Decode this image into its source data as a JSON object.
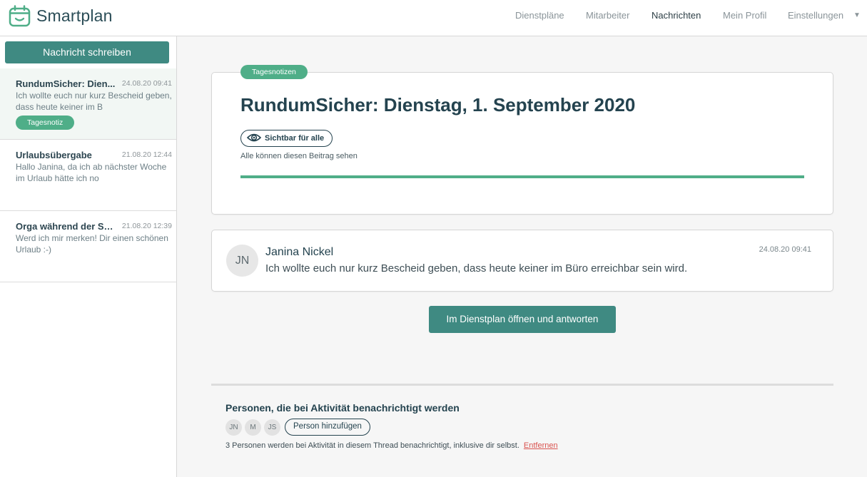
{
  "app": {
    "name": "Smartplan",
    "icon": "calendar-smile-icon",
    "accent_color": "#3f8a82",
    "badge_color": "#4fae88"
  },
  "nav": {
    "items": [
      {
        "label": "Dienstpläne",
        "active": false
      },
      {
        "label": "Mitarbeiter",
        "active": false
      },
      {
        "label": "Nachrichten",
        "active": true
      },
      {
        "label": "Mein Profil",
        "active": false
      },
      {
        "label": "Einstellungen",
        "active": false
      }
    ],
    "dropdown_icon": "caret-down-icon"
  },
  "sidebar": {
    "compose_label": "Nachricht schreiben",
    "threads": [
      {
        "title": "RundumSicher: Dien...",
        "date": "24.08.20 09:41",
        "preview": "Ich wollte euch nur kurz Bescheid geben, dass heute keiner im B",
        "tag": "Tagesnotiz",
        "selected": true
      },
      {
        "title": "Urlaubsübergabe",
        "date": "21.08.20 12:44",
        "preview": "Hallo Janina, da ich ab nächster Woche im Urlaub hätte ich no",
        "tag": "",
        "selected": false
      },
      {
        "title": "Orga während der So...",
        "date": "21.08.20 12:39",
        "preview": "Werd ich mir merken! Dir einen schönen Urlaub :-)",
        "tag": "",
        "selected": false
      }
    ]
  },
  "post": {
    "tag": "Tagesnotizen",
    "title": "RundumSicher: Dienstag, 1. September 2020",
    "visibility_label": "Sichtbar für alle",
    "visibility_icon": "eye-icon",
    "visibility_description": "Alle können diesen Beitrag sehen",
    "progress_fraction": 1.0
  },
  "message": {
    "author_initials": "JN",
    "author": "Janina Nickel",
    "date": "24.08.20 09:41",
    "text": "Ich wollte euch nur kurz Bescheid geben, dass heute keiner im Büro erreichbar sein wird."
  },
  "reply_button_label": "Im Dienstplan öffnen und antworten",
  "notifications": {
    "title": "Personen, die bei Aktivität benachrichtigt werden",
    "people": [
      "JN",
      "M",
      "JS"
    ],
    "add_label": "Person hinzufügen",
    "info": "3 Personen werden bei Aktivität in diesem Thread benachrichtigt, inklusive dir selbst.",
    "remove_label": "Entfernen"
  }
}
